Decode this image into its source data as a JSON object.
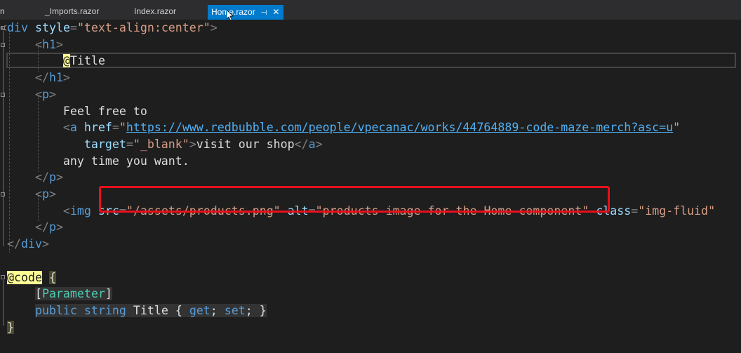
{
  "tabs": [
    {
      "label": "n",
      "active": false
    },
    {
      "label": "_Imports.razor",
      "active": false
    },
    {
      "label": "Index.razor",
      "active": false
    },
    {
      "label": "Home.razor",
      "active": true,
      "pin_glyph": "⊣",
      "close_glyph": "✕"
    }
  ],
  "code": {
    "l1": {
      "open": "<",
      "tag": "div",
      "attr": "style",
      "eq": "=",
      "val": "\"text-align:center\"",
      "close": ">"
    },
    "l2": {
      "open": "<",
      "tag": "h1",
      "close": ">"
    },
    "l3": {
      "razor": "@",
      "text": "Title"
    },
    "l4": {
      "open": "</",
      "tag": "h1",
      "close": ">"
    },
    "l5": {
      "open": "<",
      "tag": "p",
      "close": ">"
    },
    "l6": {
      "text": "Feel free to"
    },
    "l7": {
      "open": "<",
      "tag": "a",
      "attr": "href",
      "eq": "=",
      "q1": "\"",
      "url": "https://www.redbubble.com/people/vpecanac/works/44764889-code-maze-merch?asc=u",
      "q2": "\""
    },
    "l8": {
      "attr": "target",
      "eq": "=",
      "val": "\"_blank\"",
      "close": ">",
      "text": "visit our shop",
      "endopen": "</",
      "endtag": "a",
      "endclose": ">"
    },
    "l9": {
      "text": "any time you want."
    },
    "l10": {
      "open": "</",
      "tag": "p",
      "close": ">"
    },
    "l11": {
      "open": "<",
      "tag": "p",
      "close": ">"
    },
    "l12": {
      "open": "<",
      "tag": "img",
      "attr1": "src",
      "eq1": "=",
      "val1": "\"/assets/products.png\"",
      "attr2": "alt",
      "eq2": "=",
      "val2": "\"products image for the Home component\"",
      "attr3": "class",
      "eq3": "=",
      "val3": "\"img-fluid\""
    },
    "l13": {
      "open": "</",
      "tag": "p",
      "close": ">"
    },
    "l14": {
      "open": "</",
      "tag": "div",
      "close": ">"
    },
    "l16": {
      "razor": "@code",
      "brace": "{"
    },
    "l17": {
      "lb": "[",
      "attr": "Parameter",
      "rb": "]"
    },
    "l18": {
      "kw1": "public",
      "kw2": "string",
      "name": "Title",
      "ob": "{",
      "get": "get",
      "semi1": ";",
      "set": "set",
      "semi2": ";",
      "cb": "}"
    },
    "l19": {
      "brace": "}"
    }
  },
  "colors": {
    "background": "#1e1e1e",
    "tag": "#569cd6",
    "attribute": "#9cdcfe",
    "string": "#d69d85",
    "razor_highlight": "#fffc94",
    "annotation_box": "#e8101c",
    "active_tab": "#007acc"
  }
}
